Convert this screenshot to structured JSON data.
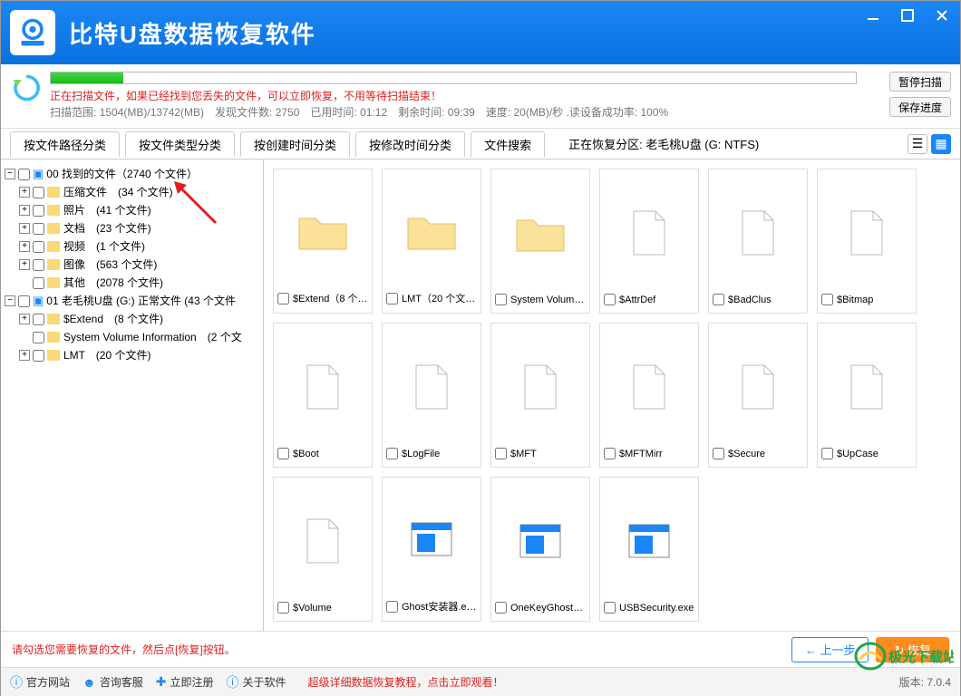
{
  "app": {
    "title": "比特U盘数据恢复软件"
  },
  "status": {
    "warn": "正在扫描文件，如果已经找到您丢失的文件，可以立即恢复，不用等待扫描结束！",
    "line": "扫描范围: 1504(MB)/13742(MB)　发现文件数: 2750　已用时间: 01:12　剩余时间: 09:39　速度: 20(MB)/秒 .读设备成功率: 100%",
    "pause": "暂停扫描",
    "save": "保存进度"
  },
  "tabs": {
    "t0": "按文件路径分类",
    "t1": "按文件类型分类",
    "t2": "按创建时间分类",
    "t3": "按修改时间分类",
    "t4": "文件搜索",
    "partition": "正在恢复分区: 老毛桃U盘 (G: NTFS)"
  },
  "tree": {
    "r0": "00 找到的文件（2740 个文件）",
    "n0": "压缩文件　(34 个文件)",
    "n1": "照片　(41 个文件)",
    "n2": "文档　(23 个文件)",
    "n3": "视频　(1 个文件)",
    "n4": "图像　(563 个文件)",
    "n5": "其他　(2078 个文件)",
    "r1": "01 老毛桃U盘 (G:) 正常文件 (43 个文件",
    "m0": "$Extend　(8 个文件)",
    "m1": "System Volume Information　(2 个文",
    "m2": "LMT　(20 个文件)"
  },
  "items": {
    "i0": "$Extend（8 个文...",
    "i1": "LMT（20 个文件）",
    "i2": "System Volume In...",
    "i3": "$AttrDef",
    "i4": "$BadClus",
    "i5": "$Bitmap",
    "i6": "$Boot",
    "i7": "$LogFile",
    "i8": "$MFT",
    "i9": "$MFTMirr",
    "i10": "$Secure",
    "i11": "$UpCase",
    "i12": "$Volume",
    "i13": "Ghost安装器.exe",
    "i14": "OneKeyGhost.exe",
    "i15": "USBSecurity.exe"
  },
  "footer": {
    "hint": "请勾选您需要恢复的文件，然后点[恢复]按钮。",
    "prev": "上一步",
    "recover": "恢复",
    "f0": "官方网站",
    "f1": "咨询客服",
    "f2": "立即注册",
    "f3": "关于软件",
    "tutorial": "超级详细数据恢复教程，点击立即观看！",
    "brand": "极光下载站",
    "version": "版本: 7.0.4"
  }
}
